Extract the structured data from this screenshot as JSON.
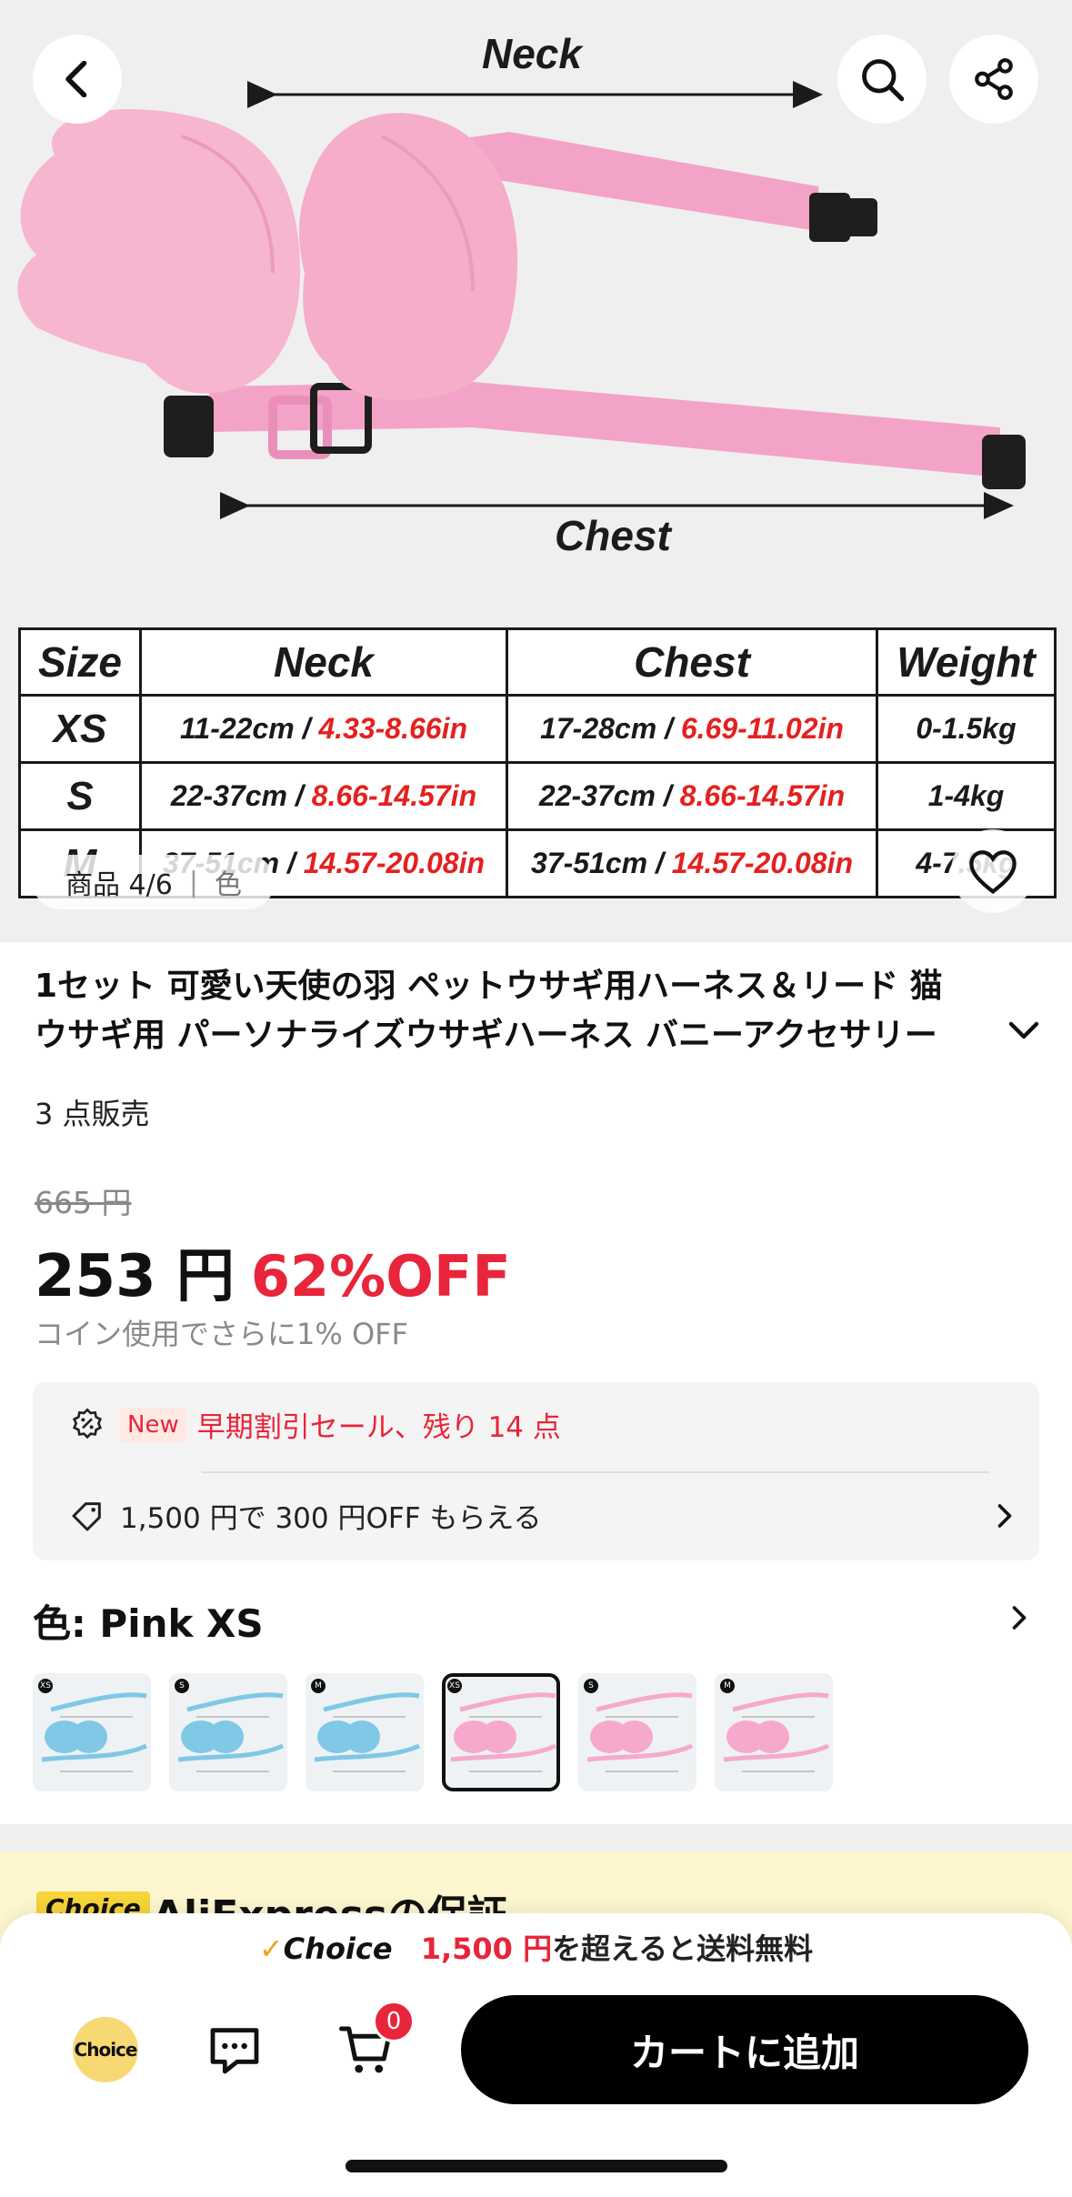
{
  "hero": {
    "neck_label": "Neck",
    "chest_label": "Chest",
    "counter": "商品 4/6",
    "counter_tab": "色",
    "size_table": {
      "headers": [
        "Size",
        "Neck",
        "Chest",
        "Weight"
      ],
      "rows": [
        {
          "size": "XS",
          "neck_cm": "11-22cm / ",
          "neck_in": "4.33-8.66in",
          "chest_cm": "17-28cm / ",
          "chest_in": "6.69-11.02in",
          "weight": "0-1.5kg"
        },
        {
          "size": "S",
          "neck_cm": "22-37cm / ",
          "neck_in": "8.66-14.57in",
          "chest_cm": "22-37cm / ",
          "chest_in": "8.66-14.57in",
          "weight": "1-4kg"
        },
        {
          "size": "M",
          "neck_cm": "37-51cm / ",
          "neck_in": "14.57-20.08in",
          "chest_cm": "37-51cm / ",
          "chest_in": "14.57-20.08in",
          "weight": "4-7.5kg"
        }
      ]
    }
  },
  "product": {
    "title_line1": "1セット 可愛い天使の羽 ペットウサギ用ハーネス＆リード 猫",
    "title_line2": "ウサギ用 パーソナライズウサギハーネス バニーアクセサリー",
    "sold": "3 点販売",
    "original_price": "665 円",
    "price": "253 円",
    "discount": "62%OFF",
    "coin_note": "コイン使用でさらに1% OFF"
  },
  "promo": {
    "new_badge": "New",
    "sale_text": "早期割引セール、残り 14 点",
    "coupon_text": "1,500 円で 300 円OFF もらえる"
  },
  "variant": {
    "label": "色: Pink XS",
    "swatches": [
      {
        "size": "XS",
        "color": "blue",
        "selected": false
      },
      {
        "size": "S",
        "color": "blue",
        "selected": false
      },
      {
        "size": "M",
        "color": "blue",
        "selected": false
      },
      {
        "size": "XS",
        "color": "pink",
        "selected": true
      },
      {
        "size": "S",
        "color": "pink",
        "selected": false
      },
      {
        "size": "M",
        "color": "pink",
        "selected": false
      }
    ]
  },
  "guarantee": {
    "badge": "Choice",
    "title": "AliExpressの保証"
  },
  "bottom": {
    "choice_word": "Choice",
    "ship_price": "1,500 円",
    "ship_rest": "を超えると送料無料",
    "choice_icon_label": "Choice",
    "cart_count": "0",
    "add_to_cart": "カートに追加"
  },
  "colors": {
    "accent_red": "#e8253a",
    "harness_pink": "#f6a9cd",
    "harness_blue": "#7fc8e6",
    "choice_yellow": "#f7d974"
  }
}
